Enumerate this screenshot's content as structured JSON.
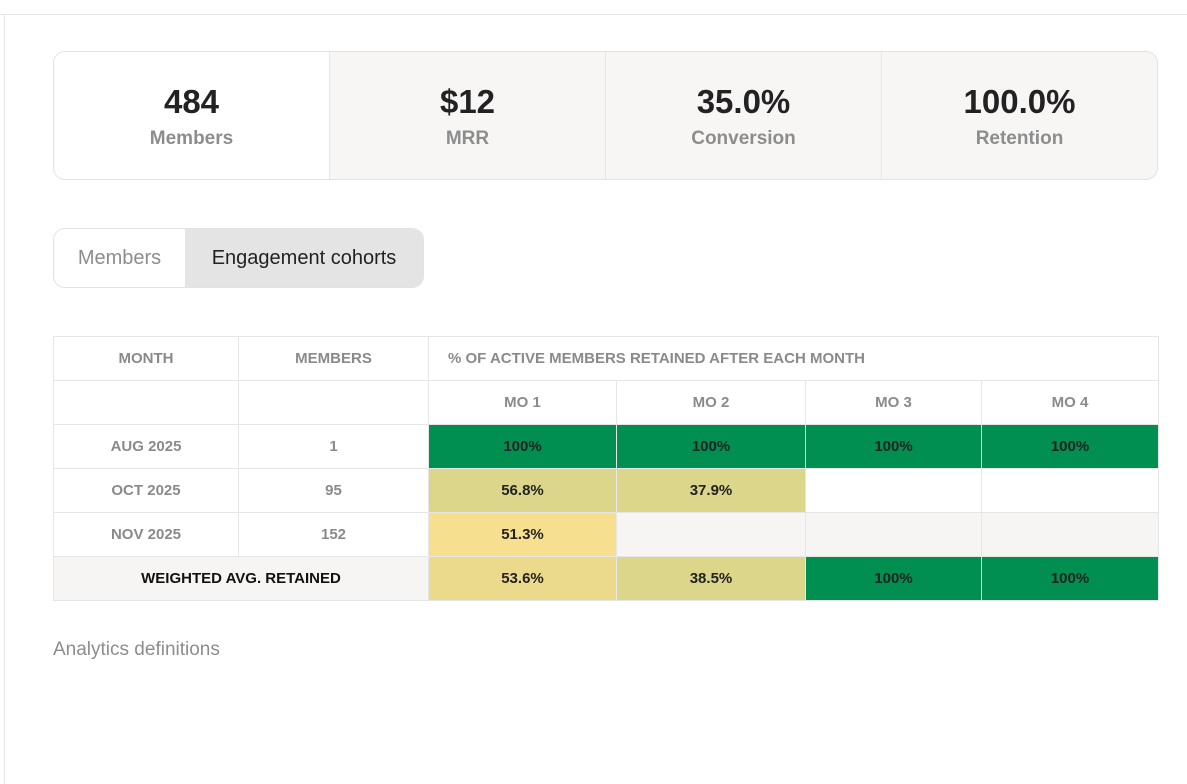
{
  "stats": [
    {
      "value": "484",
      "label": "Members"
    },
    {
      "value": "$12",
      "label": "MRR"
    },
    {
      "value": "35.0%",
      "label": "Conversion"
    },
    {
      "value": "100.0%",
      "label": "Retention"
    }
  ],
  "tabs": [
    {
      "label": "Members",
      "active": false
    },
    {
      "label": "Engagement cohorts",
      "active": true
    }
  ],
  "table": {
    "headers": {
      "month": "MONTH",
      "members": "MEMBERS",
      "retained": "% OF ACTIVE MEMBERS RETAINED AFTER EACH MONTH",
      "months": [
        "MO 1",
        "MO 2",
        "MO 3",
        "MO 4"
      ]
    },
    "rows": [
      {
        "month": "AUG 2025",
        "members": "1",
        "values": [
          "100%",
          "100%",
          "100%",
          "100%"
        ]
      },
      {
        "month": "OCT 2025",
        "members": "95",
        "values": [
          "56.8%",
          "37.9%",
          "",
          ""
        ]
      },
      {
        "month": "NOV 2025",
        "members": "152",
        "values": [
          "51.3%",
          "",
          "",
          ""
        ]
      }
    ],
    "avg": {
      "label": "WEIGHTED AVG. RETAINED",
      "values": [
        "53.6%",
        "38.5%",
        "100%",
        "100%"
      ]
    }
  },
  "colors": {
    "green": "#008f50",
    "olive": "#dbd68a",
    "yellow": "#f6df8f",
    "mid": "#ecda8c"
  },
  "footer": {
    "definitions_link": "Analytics definitions"
  }
}
